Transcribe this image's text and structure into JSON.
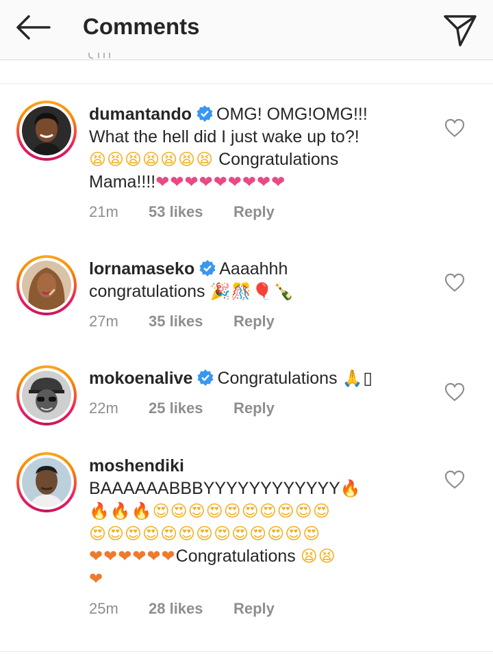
{
  "header": {
    "title": "Comments"
  },
  "comments": [
    {
      "username": "dumantando",
      "line1": "OMG! OMG!OMG!!!",
      "line2": "What the hell did I just wake up to?!",
      "line3_emoji": "😫😫😫😫😫😫😫",
      "line3_text": " Congratulations",
      "line4_text": "Mama!!!!",
      "line4_emoji": "❤❤❤❤❤❤❤❤❤",
      "time": "21m",
      "likes": "53 likes",
      "reply": "Reply"
    },
    {
      "username": "lornamaseko",
      "line1": "Aaaahhh",
      "line2_text": "congratulations ",
      "line2_emoji": "🎉🎊🎈🍾",
      "time": "27m",
      "likes": "35 likes",
      "reply": "Reply"
    },
    {
      "username": "mokoenalive",
      "line1": "Congratulations ",
      "line1_emoji": "🙏",
      "line1_box": "▯",
      "time": "22m",
      "likes": "25 likes",
      "reply": "Reply"
    },
    {
      "username": "moshendiki",
      "line1": "BAAAAAABBBYYYYYYYYYYYY",
      "line1_emoji": "🔥",
      "line2_emoji": "🔥🔥🔥😍😍😍😍😍😍😍😍😍😍",
      "line3_emoji": "😍😍😍😍😍😍😍😍😍😍😍😍😍",
      "line4_hearts": "❤❤❤❤❤❤",
      "line4_text": "Congratulations ",
      "line4_emoji": "😫😫",
      "line5_emoji": "❤",
      "time": "25m",
      "likes": "28 likes",
      "reply": "Reply"
    }
  ],
  "colors": {
    "header_bg": "#fafafa",
    "text": "#262626",
    "muted": "#8e8e8e",
    "verified_blue": "#3897f0",
    "heart_pink": "#e84a86",
    "heart_orange": "#ee7a2e"
  }
}
